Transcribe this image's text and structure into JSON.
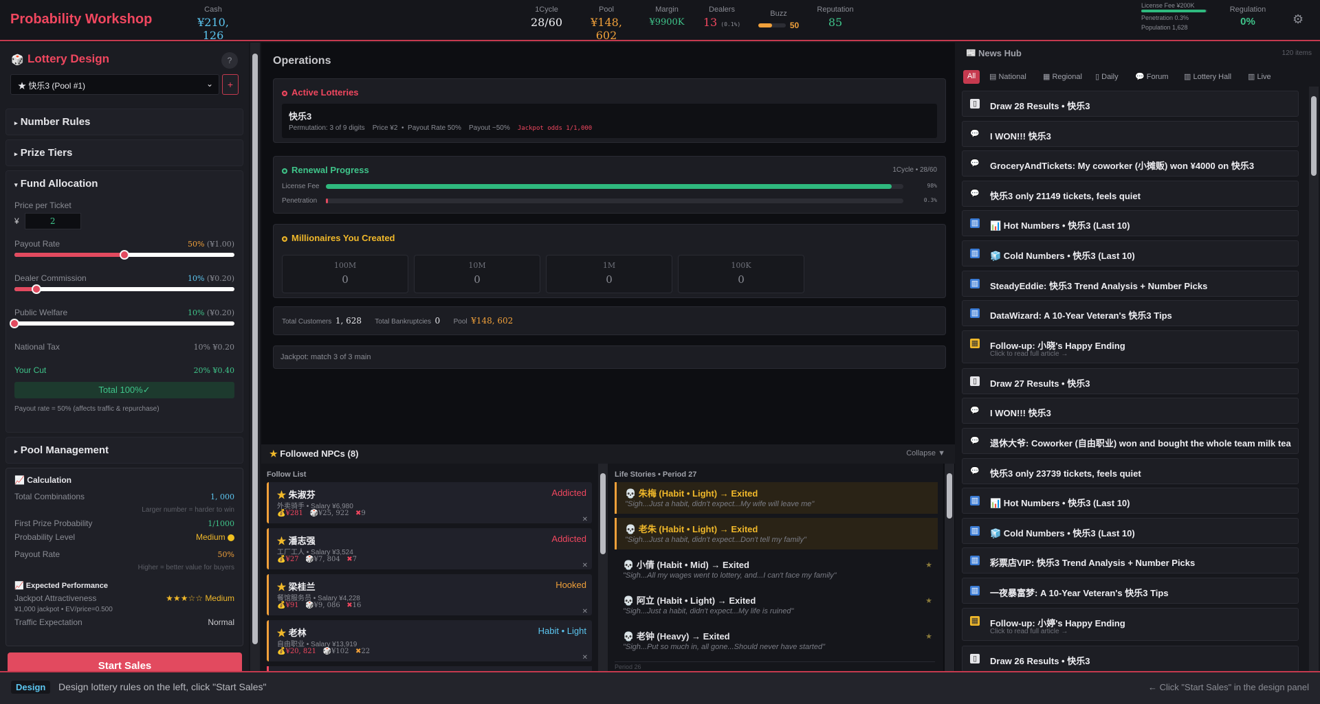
{
  "header": {
    "app_title": "Probability Workshop",
    "cash": {
      "label": "Cash",
      "value": "¥210, 126"
    },
    "cycle": {
      "label": "1Cycle",
      "value": "28/60"
    },
    "pool": {
      "label": "Pool",
      "value": "¥148, 602"
    },
    "margin": {
      "label": "Margin",
      "value": "¥9900K"
    },
    "dealers": {
      "label": "Dealers",
      "value": "13",
      "sub": "(0.1%)"
    },
    "buzz": {
      "label": "Buzz",
      "value": "50",
      "level": 0.5
    },
    "reputation": {
      "label": "Reputation",
      "value": "85"
    },
    "license_fee": "License Fee ¥200K",
    "license_level": 0.98,
    "penetration": "Penetration 0.3%",
    "population": "Population 1,628",
    "regulation": {
      "label": "Regulation",
      "value": "0%"
    },
    "settings_icon": "gear-icon"
  },
  "design": {
    "title": "Lottery Design",
    "help": "?",
    "pool_select": "★ 快乐3 (Pool #1)",
    "add": "+",
    "sections": {
      "number_rules": "Number Rules",
      "prize_tiers": "Prize Tiers",
      "fund_allocation": "Fund Allocation",
      "pool_management": "Pool Management"
    },
    "price_label": "Price per Ticket",
    "currency": "¥",
    "price_value": "2",
    "payout": {
      "label": "Payout Rate",
      "pct": "50%",
      "amt": "(¥1.00)",
      "level": 0.5
    },
    "commission": {
      "label": "Dealer Commission",
      "pct": "10%",
      "amt": "(¥0.20)",
      "level": 0.1
    },
    "welfare": {
      "label": "Public Welfare",
      "pct": "10%",
      "amt": "(¥0.20)",
      "level": 0.0
    },
    "national_tax": {
      "label": "National Tax",
      "value": "10% ¥0.20"
    },
    "your_cut": {
      "label": "Your Cut",
      "value": "20% ¥0.40"
    },
    "total": "Total 100%✓",
    "note": "Payout rate = 50% (affects traffic & repurchase)",
    "calc": {
      "title": "Calculation",
      "total_comb_label": "Total Combinations",
      "total_comb": "1, 000",
      "total_comb_hint": "Larger number = harder to win",
      "first_prize_label": "First Prize Probability",
      "first_prize": "1/1000",
      "prob_level_label": "Probability Level",
      "prob_level": "Medium",
      "payout_label": "Payout Rate",
      "payout": "50%",
      "payout_hint": "Higher = better value for buyers"
    },
    "perf": {
      "title": "Expected Performance",
      "jackpot_label": "Jackpot Attractiveness",
      "stars": "★★★☆☆",
      "stars_word": "Medium",
      "jackpot_detail": "¥1,000 jackpot • EV/price=0.500",
      "traffic_label": "Traffic Expectation",
      "traffic": "Normal"
    },
    "start": "Start Sales"
  },
  "ops": {
    "title": "Operations",
    "active_title": "Active Lotteries",
    "lottery_name": "快乐3",
    "lottery_info": "Permutation: 3 of 9 digits    Price ¥2  •  Payout Rate 50%    Payout ~50%",
    "jackpot_odds": "Jackpot odds 1/1,000",
    "renewal_title": "Renewal Progress",
    "renewal_cycle": "1Cycle • 28/60",
    "license_label": "License Fee",
    "license_pct": "98%",
    "license_level": 0.98,
    "pen_label": "Penetration",
    "pen_pct": "0.3%",
    "pen_level": 0.003,
    "millionaires_title": "Millionaires You Created",
    "millionaires": [
      {
        "label": "100M",
        "value": "0"
      },
      {
        "label": "10M",
        "value": "0"
      },
      {
        "label": "1M",
        "value": "0"
      },
      {
        "label": "100K",
        "value": "0"
      }
    ],
    "customers_label": "Total Customers",
    "customers": "1, 628",
    "bankrupt_label": "Total Bankruptcies",
    "bankrupt": "0",
    "pool_label": "Pool",
    "pool": "¥148, 602",
    "jackpot_rule": "Jackpot: match 3 of 3 main"
  },
  "npc": {
    "title": "Followed NPCs (8)",
    "collapse": "Collapse",
    "follow_list": "Follow List",
    "list": [
      {
        "name": "朱淑芬",
        "job": "外卖骑手 • Salary ¥6,980",
        "status": "Addicted",
        "a": "¥281",
        "b": "¥25, 922",
        "c": "9"
      },
      {
        "name": "潘志强",
        "job": "工厂工人 • Salary ¥3,524",
        "status": "Addicted",
        "a": "¥27",
        "b": "¥7, 804",
        "c": "7"
      },
      {
        "name": "梁桂兰",
        "job": "餐馆服务员 • Salary ¥4,228",
        "status": "Hooked",
        "a": "¥91",
        "b": "¥9, 086",
        "c": "16"
      },
      {
        "name": "老林",
        "job": "自由职业 • Salary ¥13,919",
        "status": "Habit • Light",
        "a": "¥20, 821",
        "b": "¥102",
        "c": "22"
      }
    ],
    "stories_title": "Life Stories • Period 27",
    "stories": [
      {
        "title": "朱梅 (Habit • Light) → Exited",
        "quote": "\"Sigh...Just a habit, didn't expect...My wife will leave me\""
      },
      {
        "title": "老朱 (Habit • Light) → Exited",
        "quote": "\"Sigh...Just a habit, didn't expect...Don't tell my family\""
      },
      {
        "title": "小倩 (Habit • Mid) → Exited",
        "quote": "\"Sigh...All my wages went to lottery, and...I can't face my family\""
      },
      {
        "title": "阿立 (Habit • Light) → Exited",
        "quote": "\"Sigh...Just a habit, didn't expect...My life is ruined\""
      },
      {
        "title": "老钟 (Heavy) → Exited",
        "quote": "\"Sigh...Put so much in, all gone...Should never have started\""
      }
    ],
    "period_26": "Period 26"
  },
  "news": {
    "title": "News Hub",
    "count": "120 items",
    "tabs": [
      "All",
      "National",
      "Regional",
      "Daily",
      "Forum",
      "Lottery Hall",
      "Live"
    ],
    "items": [
      {
        "text": "Draw 28 Results • 快乐3",
        "icon": "doc"
      },
      {
        "text": "I WON!!! 快乐3",
        "icon": "chat"
      },
      {
        "text": "GroceryAndTickets: My coworker (小摊贩) won ¥4000 on 快乐3",
        "icon": "chat"
      },
      {
        "text": "快乐3 only 21149 tickets, feels quiet",
        "icon": "chat"
      },
      {
        "text": "📊 Hot Numbers • 快乐3 (Last 10)",
        "icon": "chart"
      },
      {
        "text": "🧊 Cold Numbers • 快乐3 (Last 10)",
        "icon": "chart"
      },
      {
        "text": "SteadyEddie: 快乐3 Trend Analysis + Number Picks",
        "icon": "chart"
      },
      {
        "text": "DataWizard: A 10-Year Veteran's 快乐3 Tips",
        "icon": "chart"
      },
      {
        "text": "Follow-up: 小晓's Happy Ending",
        "icon": "clip",
        "hint": "Click to read full article →"
      },
      {
        "text": "Draw 27 Results • 快乐3",
        "icon": "doc"
      },
      {
        "text": "I WON!!! 快乐3",
        "icon": "chat"
      },
      {
        "text": "退休大爷: Coworker (自由职业) won and bought the whole team milk tea",
        "icon": "chat"
      },
      {
        "text": "快乐3 only 23739 tickets, feels quiet",
        "icon": "chat"
      },
      {
        "text": "📊 Hot Numbers • 快乐3 (Last 10)",
        "icon": "chart"
      },
      {
        "text": "🧊 Cold Numbers • 快乐3 (Last 10)",
        "icon": "chart"
      },
      {
        "text": "彩票店VIP: 快乐3 Trend Analysis + Number Picks",
        "icon": "chart"
      },
      {
        "text": "一夜暴富梦: A 10-Year Veteran's 快乐3 Tips",
        "icon": "chart"
      },
      {
        "text": "Follow-up: 小婷's Happy Ending",
        "icon": "clip",
        "hint": "Click to read full article →"
      },
      {
        "text": "Draw 26 Results • 快乐3",
        "icon": "doc"
      }
    ]
  },
  "status": {
    "badge": "Design",
    "message": "Design lottery rules on the left, click \"Start Sales\"",
    "hint": "← Click \"Start Sales\" in the design panel"
  }
}
